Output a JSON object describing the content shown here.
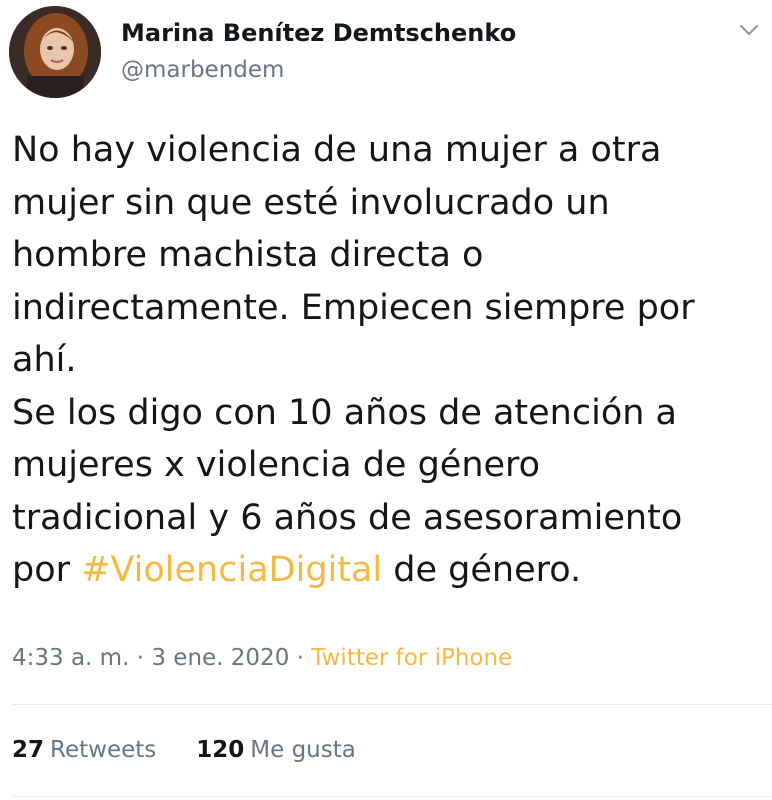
{
  "author": {
    "display_name": "Marina Benítez Demtschenko",
    "username": "@marbendem",
    "avatar_icon": "profile-photo"
  },
  "tweet": {
    "lines": [
      [
        {
          "text": "No hay violencia de una mujer a otra"
        }
      ],
      [
        {
          "text": "mujer sin que esté involucrado un"
        }
      ],
      [
        {
          "text": "hombre machista directa o"
        }
      ],
      [
        {
          "text": "indirectamente. Empiecen siempre por"
        }
      ],
      [
        {
          "text": "ahí."
        }
      ],
      [
        {
          "text": "Se los digo con 10 años de atención a"
        }
      ],
      [
        {
          "text": "mujeres x violencia de género"
        }
      ],
      [
        {
          "text": "tradicional y 6 años de asesoramiento"
        }
      ],
      [
        {
          "text": "por "
        },
        {
          "text": "#ViolenciaDigital",
          "hashtag": true
        },
        {
          "text": " de género."
        }
      ]
    ]
  },
  "meta": {
    "time": "4:33 a. m.",
    "separator": " · ",
    "date": "3 ene. 2020",
    "source": "Twitter for iPhone"
  },
  "stats": {
    "retweets_count": "27",
    "retweets_label": "Retweets",
    "likes_count": "120",
    "likes_label": "Me gusta"
  },
  "colors": {
    "hashtag": "#f5b942",
    "secondary_text": "#657786",
    "primary_text": "#14171a",
    "divider": "#e6ecf0"
  },
  "icons": {
    "menu": "chevron-down-icon"
  }
}
